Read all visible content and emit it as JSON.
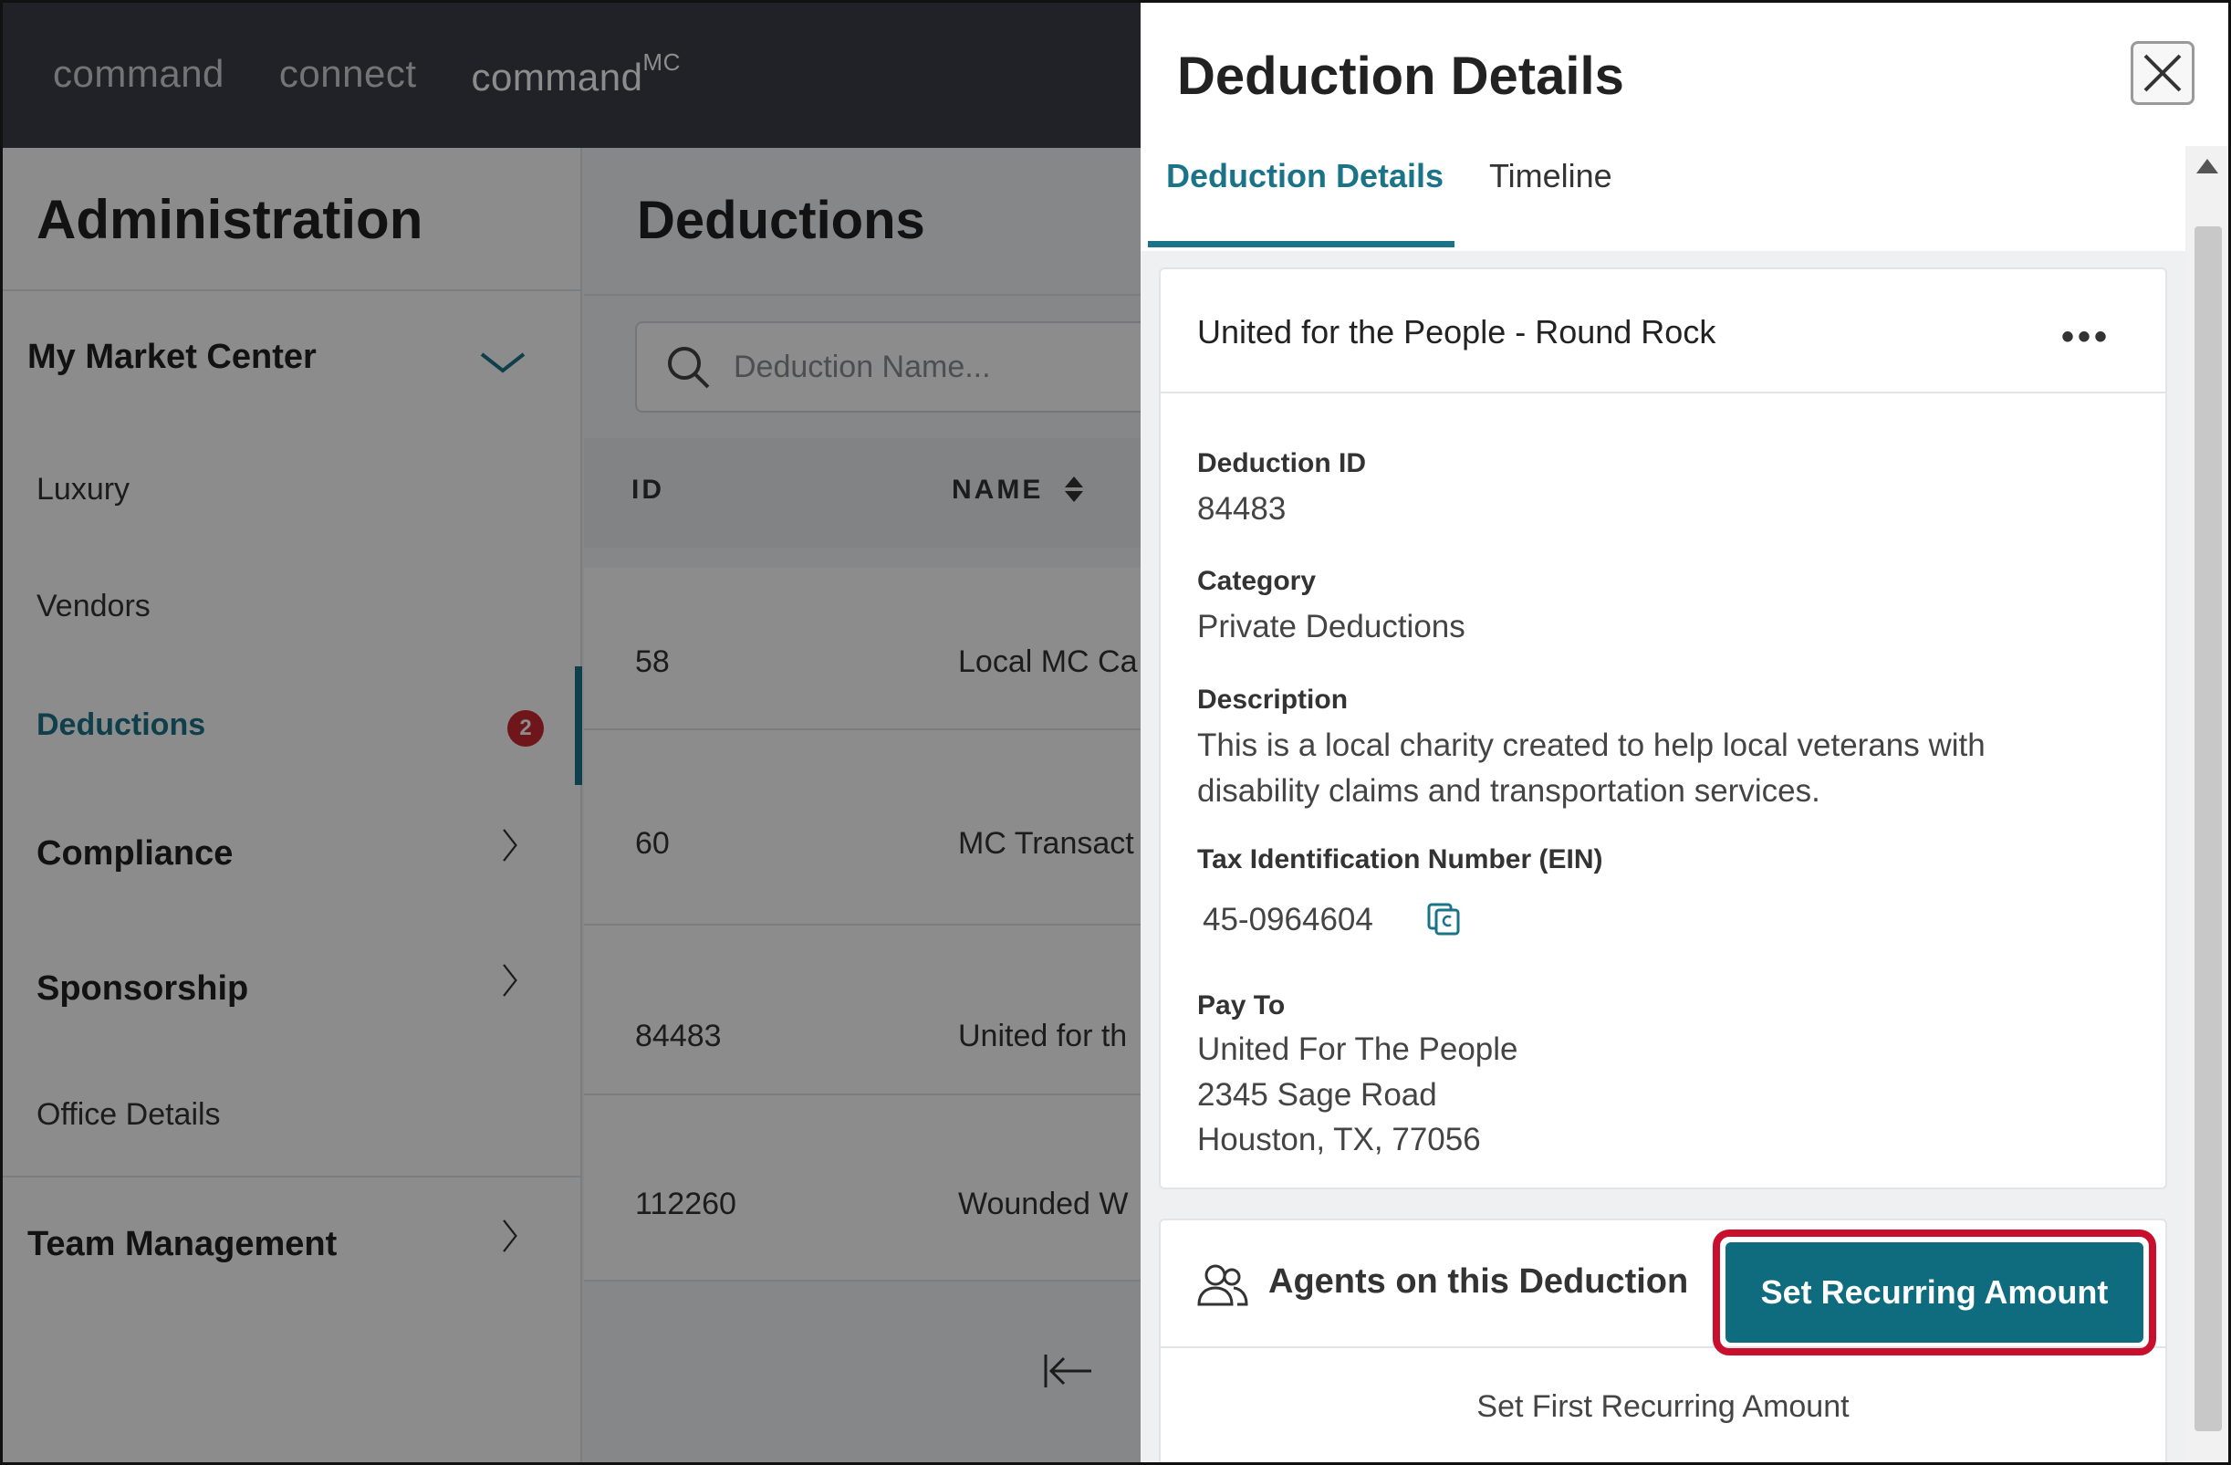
{
  "topnav": {
    "items": [
      "command",
      "connect",
      "command"
    ],
    "sup": "MC"
  },
  "sidebar": {
    "title": "Administration",
    "market_center": "My Market Center",
    "items": {
      "luxury": "Luxury",
      "vendors": "Vendors",
      "deductions": "Deductions",
      "office_details": "Office Details"
    },
    "deductions_badge": "2",
    "sections": {
      "compliance": "Compliance",
      "sponsorship": "Sponsorship",
      "team_management": "Team Management"
    }
  },
  "main": {
    "title": "Deductions",
    "search_placeholder": "Deduction Name...",
    "columns": {
      "id": "ID",
      "name": "NAME"
    },
    "rows": [
      {
        "id": "58",
        "name": "Local MC Ca"
      },
      {
        "id": "60",
        "name": "MC Transact"
      },
      {
        "id": "84483",
        "name": "United for th"
      },
      {
        "id": "112260",
        "name": "Wounded W"
      }
    ]
  },
  "panel": {
    "title": "Deduction Details",
    "tabs": {
      "details": "Deduction Details",
      "timeline": "Timeline"
    },
    "card": {
      "name": "United for the People - Round Rock",
      "more": "•••",
      "deduction_id_label": "Deduction ID",
      "deduction_id": "84483",
      "category_label": "Category",
      "category": "Private Deductions",
      "description_label": "Description",
      "description_line1": "This is a local charity created to help local veterans with",
      "description_line2": "disability claims and transportation services.",
      "tin_label": "Tax Identification Number (EIN)",
      "tin": "45-0964604",
      "payto_label": "Pay To",
      "payto_line1": "United For The People",
      "payto_line2": "2345 Sage Road",
      "payto_line3": "Houston, TX, 77056"
    },
    "agents": {
      "label": "Agents on this Deduction",
      "button": "Set Recurring Amount",
      "first": "Set First Recurring Amount"
    }
  },
  "colors": {
    "accent": "#1a7387",
    "button": "#0f6b7e",
    "highlight": "#c8102e",
    "badge": "#c8282e",
    "nav": "#3b3f47"
  }
}
